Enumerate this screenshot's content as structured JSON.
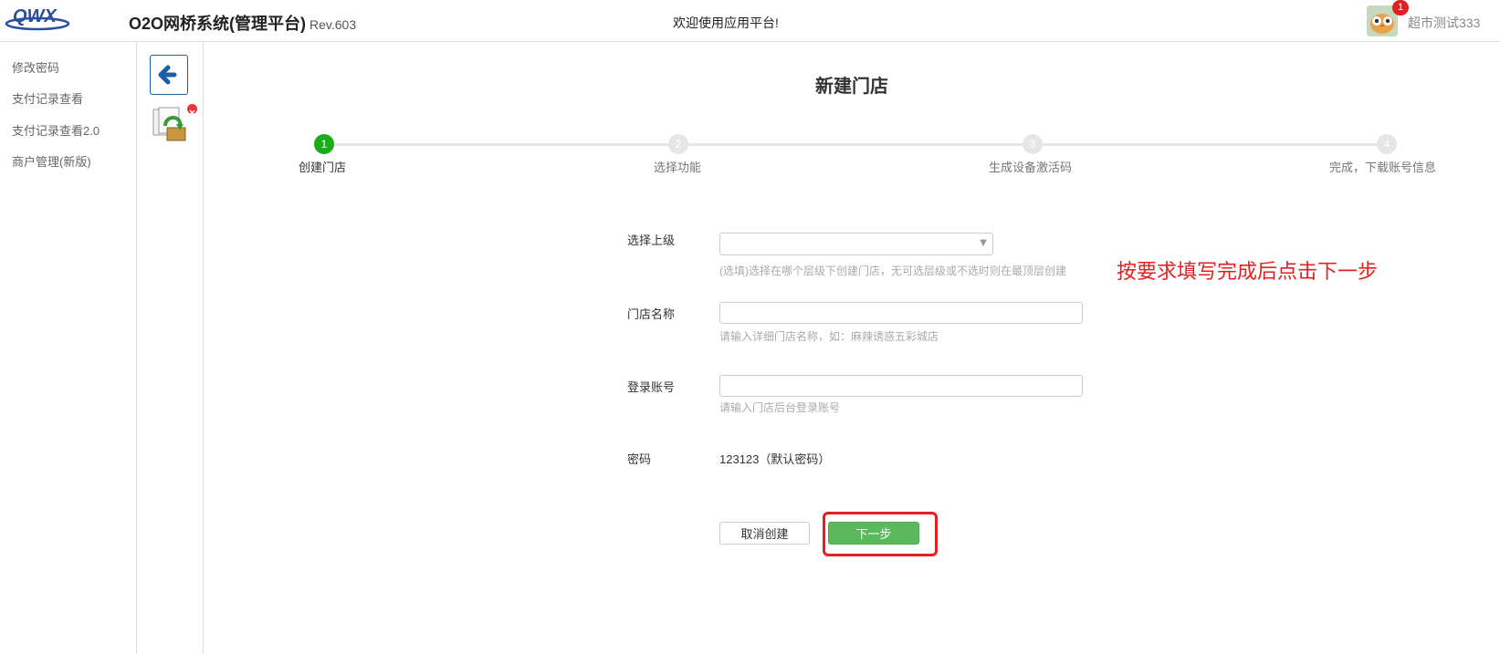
{
  "header": {
    "logo_text": "QWX",
    "title": "O2O网桥系统(管理平台)",
    "rev": "Rev.603",
    "welcome": "欢迎使用应用平台!",
    "notification_count": "1",
    "username": "超市测试333"
  },
  "sidebar": {
    "items": [
      {
        "label": "修改密码"
      },
      {
        "label": "支付记录查看"
      },
      {
        "label": "支付记录查看2.0"
      },
      {
        "label": "商户管理(新版)"
      }
    ]
  },
  "page": {
    "title": "新建门店",
    "steps": [
      {
        "num": "1",
        "label": "创建门店",
        "active": true
      },
      {
        "num": "2",
        "label": "选择功能",
        "active": false
      },
      {
        "num": "3",
        "label": "生成设备激活码",
        "active": false
      },
      {
        "num": "4",
        "label": "完成，下载账号信息",
        "active": false
      }
    ],
    "form": {
      "parent_label": "选择上级",
      "parent_value": "",
      "parent_hint": "(选填)选择在哪个层级下创建门店，无可选层级或不选时则在最顶层创建",
      "name_label": "门店名称",
      "name_value": "",
      "name_hint": "请输入详细门店名称，如：麻辣诱惑五彩城店",
      "account_label": "登录账号",
      "account_value": "",
      "account_hint": "请输入门店后台登录账号",
      "password_label": "密码",
      "password_value": "123123（默认密码）"
    },
    "buttons": {
      "cancel": "取消创建",
      "next": "下一步"
    },
    "annotation": "按要求填写完成后点击下一步"
  },
  "colors": {
    "accent_green": "#1aad19",
    "next_button": "#5cb85c",
    "annotation_red": "#e62020",
    "back_arrow_blue": "#1a5fa8"
  },
  "icons": {
    "back": "arrow-left-icon",
    "document": "document-return-icon",
    "close": "close-icon",
    "caret": "caret-down-icon"
  }
}
